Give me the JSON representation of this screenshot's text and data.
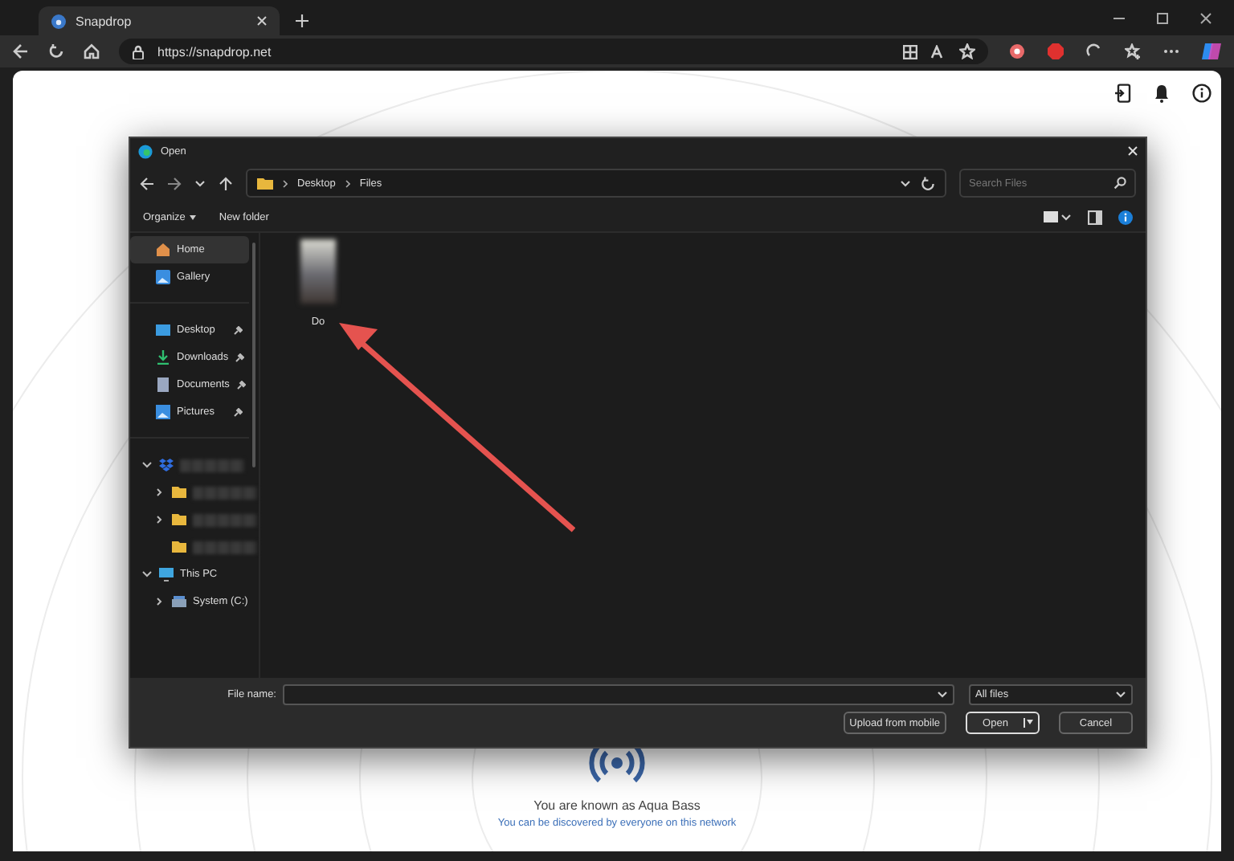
{
  "browser": {
    "tab": {
      "title": "Snapdrop",
      "selected": true
    },
    "url": "https://snapdrop.net"
  },
  "page": {
    "display_name": "You are known as Aqua Bass",
    "discovery_note": "You can be discovered by everyone on this network"
  },
  "dialog": {
    "title": "Open",
    "breadcrumb": [
      "Desktop",
      "Files"
    ],
    "search": {
      "placeholder": "Search Files"
    },
    "toolbar": [
      {
        "label": "Organize",
        "kind": "menu"
      },
      {
        "label": "New folder",
        "kind": "plain"
      }
    ],
    "nav_groups": [
      [
        {
          "label": "Home",
          "kind": "home",
          "selected": true,
          "pinned": false
        },
        {
          "label": "Gallery",
          "kind": "gallery",
          "selected": false,
          "pinned": false
        }
      ],
      [
        {
          "label": "Desktop",
          "kind": "desktop",
          "selected": false,
          "pinned": true
        },
        {
          "label": "Downloads",
          "kind": "download",
          "selected": false,
          "pinned": true
        },
        {
          "label": "Documents",
          "kind": "document",
          "selected": false,
          "pinned": true
        },
        {
          "label": "Pictures",
          "kind": "picture",
          "selected": false,
          "pinned": true
        }
      ]
    ],
    "tree": [
      {
        "kind": "cloud",
        "expanded": true,
        "children": [
          {
            "kind": "folder",
            "expanded": false
          },
          {
            "kind": "folder",
            "expanded": false
          },
          {
            "kind": "folder"
          }
        ]
      },
      {
        "label": "This PC",
        "kind": "pc",
        "expanded": true,
        "children": [
          {
            "label": "System (C:)",
            "kind": "drive",
            "expanded": false
          }
        ]
      }
    ],
    "files": [
      {
        "name": "Do",
        "kind": "image"
      }
    ],
    "file_name_label": "File name:",
    "filter": "All files",
    "buttons": [
      {
        "label": "Upload from mobile",
        "kind": "plain",
        "default": false
      },
      {
        "label": "Open",
        "kind": "split",
        "default": true
      },
      {
        "label": "Cancel",
        "kind": "plain",
        "default": false
      }
    ]
  }
}
